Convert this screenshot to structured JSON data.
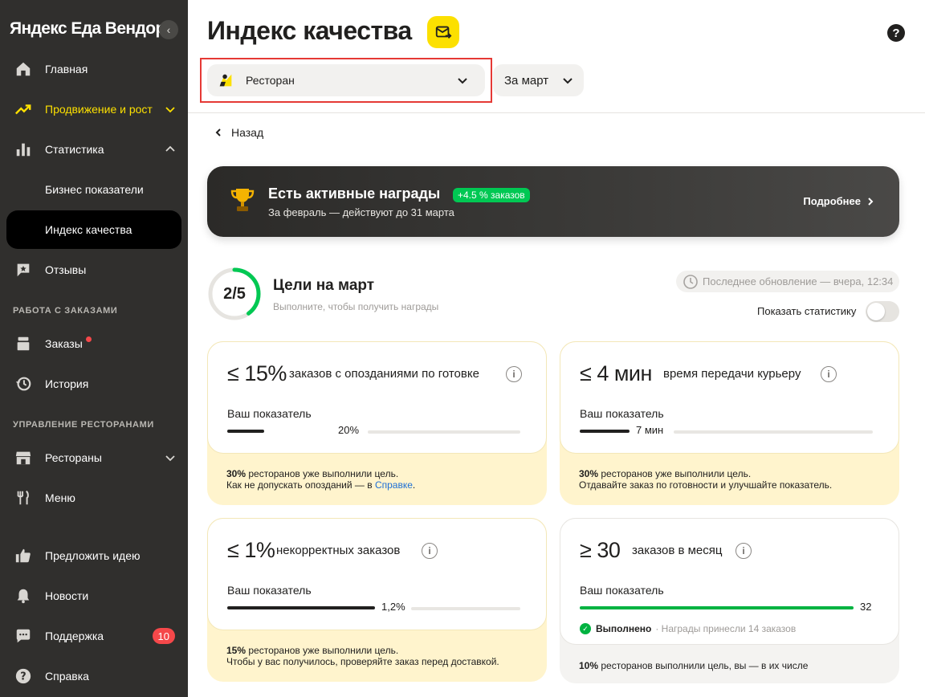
{
  "sidebar": {
    "brand": "Яндекс Еда Вендор",
    "items": [
      {
        "label": "Главная"
      },
      {
        "label": "Продвижение и рост"
      },
      {
        "label": "Статистика"
      },
      {
        "label": "Бизнес показатели"
      },
      {
        "label": "Индекс качества"
      },
      {
        "label": "Отзывы"
      },
      {
        "label": "Заказы"
      },
      {
        "label": "История"
      },
      {
        "label": "Рестораны"
      },
      {
        "label": "Меню"
      },
      {
        "label": "Предложить идею"
      },
      {
        "label": "Новости"
      },
      {
        "label": "Поддержка",
        "badge": "10"
      },
      {
        "label": "Справка"
      }
    ],
    "sections": [
      "РАБОТА С ЗАКАЗАМИ",
      "УПРАВЛЕНИЕ РЕСТОРАНАМИ"
    ]
  },
  "header": {
    "title": "Индекс качества",
    "restaurant_select": "Ресторан",
    "period_select": "За март",
    "help": "?"
  },
  "back_label": "Назад",
  "rewards": {
    "title": "Есть активные награды",
    "pill": "+4.5 % заказов",
    "subtitle": "За февраль — действуют до 31 марта",
    "more": "Подробнее"
  },
  "goals": {
    "count": "2/5",
    "done_fraction": 0.4,
    "title": "Цели на март",
    "subtitle": "Выполните, чтобы получить награды",
    "updated": "Последнее обновление — вчера, 12:34",
    "toggle_label": "Показать статистику"
  },
  "cards": [
    {
      "target": "≤ 15%",
      "metric": "заказов с опозданиями по готовке",
      "label": "Ваш показатель",
      "value": "20%",
      "fill": 0.35,
      "foot_bold": "30%",
      "foot_1": " ресторанов уже выполнили цель.",
      "foot_2": "Как не допускать опозданий — в ",
      "foot_link": "Справке",
      "foot_end": "."
    },
    {
      "target": "≤ 4 мин",
      "metric": "время передачи курьеру",
      "label": "Ваш показатель",
      "value": "7 мин",
      "fill": 0.17,
      "foot_bold": "30%",
      "foot_1": " ресторанов уже выполнили цель.",
      "foot_2": "Отдавайте заказ по готовности и улучшайте показатель."
    },
    {
      "target": "≤ 1%",
      "metric": "некорректных заказов",
      "label": "Ваш показатель",
      "value": "1,2%",
      "fill": 0.5,
      "foot_bold": "15%",
      "foot_1": " ресторанов уже выполнили цель.",
      "foot_2": "Чтобы у вас получилось, проверяйте заказ перед доставкой."
    },
    {
      "target": "≥ 30",
      "metric": "заказов в месяц",
      "label": "Ваш показатель",
      "value": "32",
      "fill": 1.0,
      "done_text": "Выполнено",
      "done_note": "· Награды принесли 14 заказов",
      "foot_bold": "10%",
      "foot_1": " ресторанов выполнили цель, вы — в их числе"
    }
  ],
  "colors": {
    "accent": "#fce000",
    "sidebar": "#302f2d",
    "success": "#00b341",
    "link": "#1d6fd6",
    "alert": "#f5484a"
  }
}
